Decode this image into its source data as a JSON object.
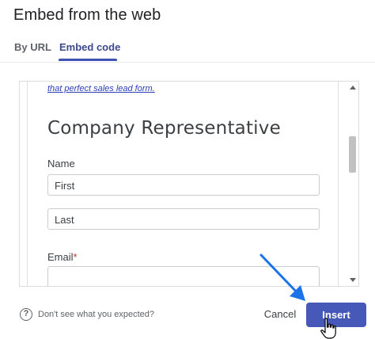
{
  "dialog": {
    "title": "Embed from the web",
    "tabs": [
      {
        "label": "By URL",
        "active": false
      },
      {
        "label": "Embed code",
        "active": true
      }
    ]
  },
  "preview": {
    "lead_link_text": "that perfect sales lead form.",
    "section_title": "Company Representative",
    "fields": {
      "name_label": "Name",
      "first_placeholder": "First",
      "last_placeholder": "Last",
      "email_label": "Email",
      "email_required_mark": "*"
    }
  },
  "footer": {
    "help_icon_glyph": "?",
    "help_text": "Don't see what you expected?",
    "cancel_label": "Cancel",
    "insert_label": "Insert"
  },
  "colors": {
    "accent": "#3f51b5",
    "insert_button": "#4759b8",
    "arrow": "#1a73e8",
    "required": "#d93025",
    "link": "#2b3fb5"
  },
  "icons": {
    "help": "help-circle-icon",
    "annotation_arrow": "arrow-icon",
    "pointer": "hand-cursor-icon"
  }
}
